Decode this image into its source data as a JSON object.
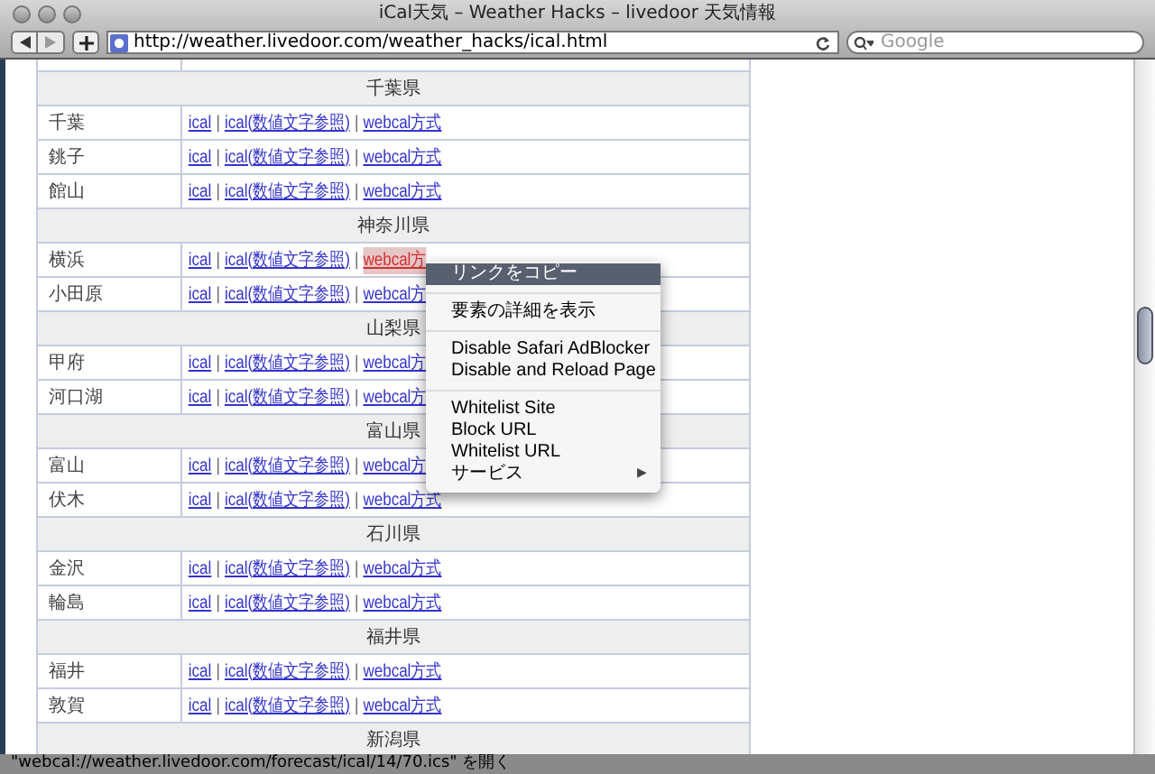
{
  "window": {
    "title": "iCal天気 – Weather Hacks – livedoor 天気情報"
  },
  "toolbar": {
    "url": "http://weather.livedoor.com/weather_hacks/ical.html",
    "search": {
      "placeholder": "Google"
    }
  },
  "table": {
    "rows": [
      {
        "kind": "prefecture",
        "label": "千葉県"
      },
      {
        "kind": "city",
        "name": "千葉",
        "links": [
          {
            "kind": "link",
            "text": "ical",
            "selected": false
          },
          {
            "kind": "separator",
            "text": "|"
          },
          {
            "kind": "link",
            "text": "ical(数値文字参照)",
            "selected": false
          },
          {
            "kind": "separator",
            "text": "|"
          },
          {
            "kind": "link",
            "text": "webcal方式",
            "selected": false
          }
        ]
      },
      {
        "kind": "city",
        "name": "銚子",
        "links": [
          {
            "kind": "link",
            "text": "ical",
            "selected": false
          },
          {
            "kind": "separator",
            "text": "|"
          },
          {
            "kind": "link",
            "text": "ical(数値文字参照)",
            "selected": false
          },
          {
            "kind": "separator",
            "text": "|"
          },
          {
            "kind": "link",
            "text": "webcal方式",
            "selected": false
          }
        ]
      },
      {
        "kind": "city",
        "name": "館山",
        "links": [
          {
            "kind": "link",
            "text": "ical",
            "selected": false
          },
          {
            "kind": "separator",
            "text": "|"
          },
          {
            "kind": "link",
            "text": "ical(数値文字参照)",
            "selected": false
          },
          {
            "kind": "separator",
            "text": "|"
          },
          {
            "kind": "link",
            "text": "webcal方式",
            "selected": false
          }
        ]
      },
      {
        "kind": "prefecture",
        "label": "神奈川県"
      },
      {
        "kind": "city",
        "name": "横浜",
        "links": [
          {
            "kind": "link",
            "text": "ical",
            "selected": false
          },
          {
            "kind": "separator",
            "text": "|"
          },
          {
            "kind": "link",
            "text": "ical(数値文字参照)",
            "selected": false
          },
          {
            "kind": "separator",
            "text": "|"
          },
          {
            "kind": "link",
            "text": "webcal方",
            "selected": true
          }
        ]
      },
      {
        "kind": "city",
        "name": "小田原",
        "links": [
          {
            "kind": "link",
            "text": "ical",
            "selected": false
          },
          {
            "kind": "separator",
            "text": "|"
          },
          {
            "kind": "link",
            "text": "ical(数値文字参照)",
            "selected": false
          },
          {
            "kind": "separator",
            "text": "|"
          },
          {
            "kind": "link",
            "text": "webcal方",
            "selected": false
          }
        ]
      },
      {
        "kind": "prefecture",
        "label": "山梨県"
      },
      {
        "kind": "city",
        "name": "甲府",
        "links": [
          {
            "kind": "link",
            "text": "ical",
            "selected": false
          },
          {
            "kind": "separator",
            "text": "|"
          },
          {
            "kind": "link",
            "text": "ical(数値文字参照)",
            "selected": false
          },
          {
            "kind": "separator",
            "text": "|"
          },
          {
            "kind": "link",
            "text": "webcal方",
            "selected": false
          }
        ]
      },
      {
        "kind": "city",
        "name": "河口湖",
        "links": [
          {
            "kind": "link",
            "text": "ical",
            "selected": false
          },
          {
            "kind": "separator",
            "text": "|"
          },
          {
            "kind": "link",
            "text": "ical(数値文字参照)",
            "selected": false
          },
          {
            "kind": "separator",
            "text": "|"
          },
          {
            "kind": "link",
            "text": "webcal方",
            "selected": false
          }
        ]
      },
      {
        "kind": "prefecture",
        "label": "富山県"
      },
      {
        "kind": "city",
        "name": "富山",
        "links": [
          {
            "kind": "link",
            "text": "ical",
            "selected": false
          },
          {
            "kind": "separator",
            "text": "|"
          },
          {
            "kind": "link",
            "text": "ical(数値文字参照)",
            "selected": false
          },
          {
            "kind": "separator",
            "text": "|"
          },
          {
            "kind": "link",
            "text": "webcal方",
            "selected": false
          }
        ]
      },
      {
        "kind": "city",
        "name": "伏木",
        "links": [
          {
            "kind": "link",
            "text": "ical",
            "selected": false
          },
          {
            "kind": "separator",
            "text": "|"
          },
          {
            "kind": "link",
            "text": "ical(数値文字参照)",
            "selected": false
          },
          {
            "kind": "separator",
            "text": "|"
          },
          {
            "kind": "link",
            "text": "webcal方式",
            "selected": false
          }
        ]
      },
      {
        "kind": "prefecture",
        "label": "石川県"
      },
      {
        "kind": "city",
        "name": "金沢",
        "links": [
          {
            "kind": "link",
            "text": "ical",
            "selected": false
          },
          {
            "kind": "separator",
            "text": "|"
          },
          {
            "kind": "link",
            "text": "ical(数値文字参照)",
            "selected": false
          },
          {
            "kind": "separator",
            "text": "|"
          },
          {
            "kind": "link",
            "text": "webcal方式",
            "selected": false
          }
        ]
      },
      {
        "kind": "city",
        "name": "輪島",
        "links": [
          {
            "kind": "link",
            "text": "ical",
            "selected": false
          },
          {
            "kind": "separator",
            "text": "|"
          },
          {
            "kind": "link",
            "text": "ical(数値文字参照)",
            "selected": false
          },
          {
            "kind": "separator",
            "text": "|"
          },
          {
            "kind": "link",
            "text": "webcal方式",
            "selected": false
          }
        ]
      },
      {
        "kind": "prefecture",
        "label": "福井県"
      },
      {
        "kind": "city",
        "name": "福井",
        "links": [
          {
            "kind": "link",
            "text": "ical",
            "selected": false
          },
          {
            "kind": "separator",
            "text": "|"
          },
          {
            "kind": "link",
            "text": "ical(数値文字参照)",
            "selected": false
          },
          {
            "kind": "separator",
            "text": "|"
          },
          {
            "kind": "link",
            "text": "webcal方式",
            "selected": false
          }
        ]
      },
      {
        "kind": "city",
        "name": "敦賀",
        "links": [
          {
            "kind": "link",
            "text": "ical",
            "selected": false
          },
          {
            "kind": "separator",
            "text": "|"
          },
          {
            "kind": "link",
            "text": "ical(数値文字参照)",
            "selected": false
          },
          {
            "kind": "separator",
            "text": "|"
          },
          {
            "kind": "link",
            "text": "webcal方式",
            "selected": false
          }
        ]
      },
      {
        "kind": "prefecture",
        "label": "新潟県"
      }
    ]
  },
  "context_menu": {
    "items": [
      {
        "kind": "item",
        "label": "リンクをコピー",
        "selected": true
      },
      {
        "kind": "separator"
      },
      {
        "kind": "item",
        "label": "要素の詳細を表示",
        "selected": false
      },
      {
        "kind": "separator"
      },
      {
        "kind": "item",
        "label": "Disable Safari AdBlocker",
        "selected": false
      },
      {
        "kind": "item",
        "label": "Disable and Reload Page",
        "selected": false
      },
      {
        "kind": "separator"
      },
      {
        "kind": "item",
        "label": "Whitelist Site",
        "selected": false
      },
      {
        "kind": "item",
        "label": "Block URL",
        "selected": false
      },
      {
        "kind": "item",
        "label": "Whitelist URL",
        "selected": false
      },
      {
        "kind": "submenu",
        "label": "サービス",
        "arrow": "▶",
        "selected": false
      }
    ]
  },
  "status_bar": {
    "text": "\"webcal://weather.livedoor.com/forecast/ical/14/70.ics\" を開く"
  }
}
